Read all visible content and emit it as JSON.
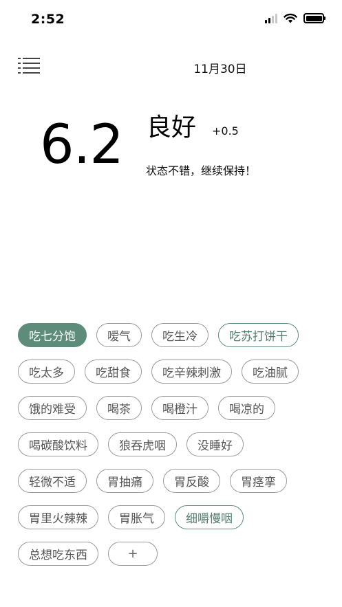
{
  "status_bar": {
    "time": "2:52"
  },
  "header": {
    "date": "11月30日"
  },
  "summary": {
    "score": "6.2",
    "rating": "良好",
    "delta": "+0.5",
    "message": "状态不错，继续保持！"
  },
  "tags": {
    "rows": [
      [
        {
          "label": "吃七分饱",
          "state": "selected"
        },
        {
          "label": "嗳气",
          "state": "normal"
        },
        {
          "label": "吃生冷",
          "state": "normal"
        },
        {
          "label": "吃苏打饼干",
          "state": "highlight"
        }
      ],
      [
        {
          "label": "吃太多",
          "state": "normal"
        },
        {
          "label": "吃甜食",
          "state": "normal"
        },
        {
          "label": "吃辛辣刺激",
          "state": "normal"
        },
        {
          "label": "吃油腻",
          "state": "normal"
        }
      ],
      [
        {
          "label": "饿的难受",
          "state": "normal"
        },
        {
          "label": "喝茶",
          "state": "normal"
        },
        {
          "label": "喝橙汁",
          "state": "normal"
        },
        {
          "label": "喝凉的",
          "state": "normal"
        }
      ],
      [
        {
          "label": "喝碳酸饮料",
          "state": "normal"
        },
        {
          "label": "狼吞虎咽",
          "state": "normal"
        },
        {
          "label": "没睡好",
          "state": "normal"
        }
      ],
      [
        {
          "label": "轻微不适",
          "state": "normal"
        },
        {
          "label": "胃抽痛",
          "state": "normal"
        },
        {
          "label": "胃反酸",
          "state": "normal"
        },
        {
          "label": "胃痉挛",
          "state": "normal"
        }
      ],
      [
        {
          "label": "胃里火辣辣",
          "state": "normal"
        },
        {
          "label": "胃胀气",
          "state": "normal"
        },
        {
          "label": "细嚼慢咽",
          "state": "highlight"
        }
      ],
      [
        {
          "label": "总想吃东西",
          "state": "normal"
        },
        {
          "label": "+",
          "state": "add"
        }
      ]
    ]
  },
  "colors": {
    "accent": "#5e8c7b",
    "tag_border": "#9a9a9a",
    "tag_text": "#555555"
  },
  "icons": {
    "menu": "menu-icon",
    "signal": "signal-icon",
    "wifi": "wifi-icon",
    "battery": "battery-icon"
  }
}
